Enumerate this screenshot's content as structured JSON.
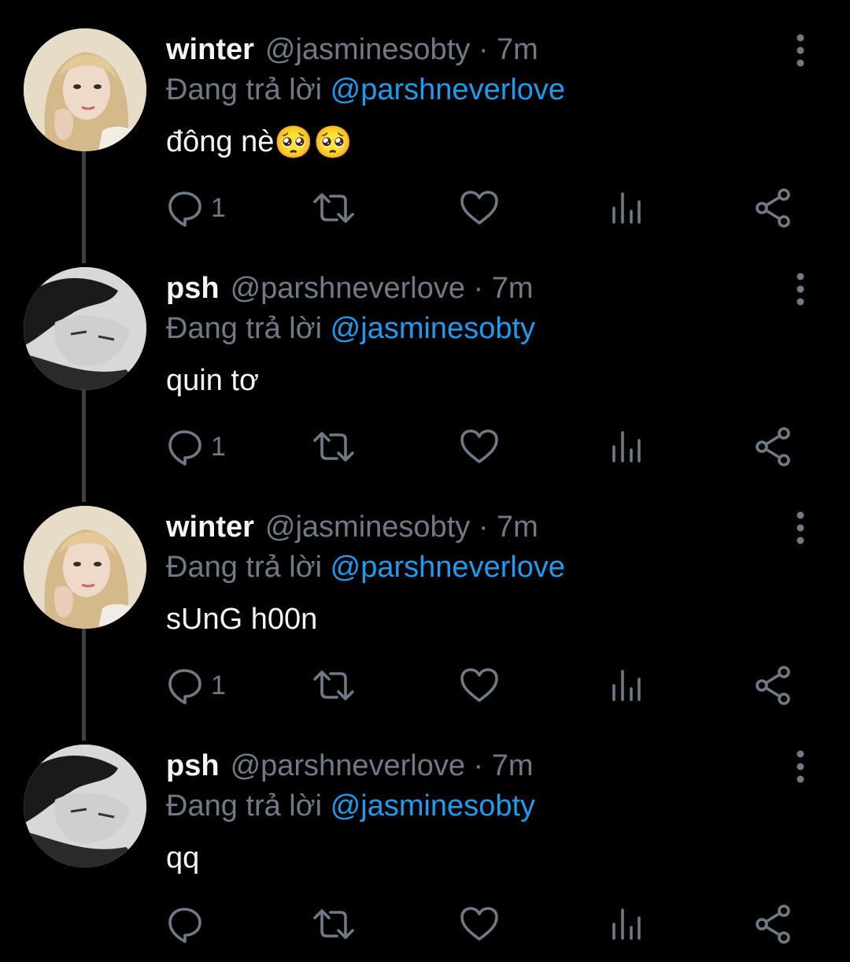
{
  "reply_prefix": "Đang trả lời",
  "tweets": [
    {
      "name": "winter",
      "handle": "@jasminesobty",
      "sep": "·",
      "time": "7m",
      "mention": "@parshneverlove",
      "text": "đông nè",
      "emoji": "🥺🥺",
      "reply_count": "1",
      "avatar": "winter-avatar"
    },
    {
      "name": "psh",
      "handle": "@parshneverlove",
      "sep": "·",
      "time": "7m",
      "mention": "@jasminesobty",
      "text": "quin tơ",
      "emoji": "",
      "reply_count": "1",
      "avatar": "psh-avatar"
    },
    {
      "name": "winter",
      "handle": "@jasminesobty",
      "sep": "·",
      "time": "7m",
      "mention": "@parshneverlove",
      "text": "sUnG h00n",
      "emoji": "",
      "reply_count": "1",
      "avatar": "winter-avatar"
    },
    {
      "name": "psh",
      "handle": "@parshneverlove",
      "sep": "·",
      "time": "7m",
      "mention": "@jasminesobty",
      "text": "qq",
      "emoji": "",
      "reply_count": "",
      "avatar": "psh-avatar"
    }
  ],
  "colors": {
    "background": "#000000",
    "text_primary": "#f2f4f5",
    "text_secondary": "#6e7b86",
    "link": "#1d9bf0",
    "thread_line": "#3d4042"
  },
  "icons": [
    "reply-icon",
    "retweet-icon",
    "like-icon",
    "analytics-icon",
    "share-icon",
    "more-options-icon"
  ]
}
